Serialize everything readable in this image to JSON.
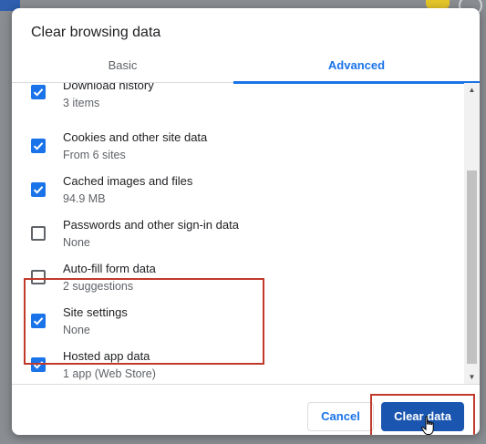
{
  "dialog": {
    "title": "Clear browsing data",
    "tabs": [
      {
        "label": "Basic",
        "selected": false
      },
      {
        "label": "Advanced",
        "selected": true
      }
    ],
    "items": [
      {
        "label": "Download history",
        "detail": "3 items",
        "checked": true
      },
      {
        "label": "Cookies and other site data",
        "detail": "From 6 sites",
        "checked": true
      },
      {
        "label": "Cached images and files",
        "detail": "94.9 MB",
        "checked": true
      },
      {
        "label": "Passwords and other sign-in data",
        "detail": "None",
        "checked": false
      },
      {
        "label": "Auto-fill form data",
        "detail": "2 suggestions",
        "checked": false
      },
      {
        "label": "Site settings",
        "detail": "None",
        "checked": true
      },
      {
        "label": "Hosted app data",
        "detail": "1 app (Web Store)",
        "checked": true
      }
    ],
    "buttons": {
      "cancel": "Cancel",
      "clear": "Clear data"
    }
  },
  "colors": {
    "accent": "#1a73e8",
    "primary_button": "#1a56b0",
    "highlight_outline": "#c0392b"
  },
  "icons": {
    "checkbox_checked": "checkmark-icon",
    "scroll_up": "chevron-up-icon",
    "scroll_down": "chevron-down-icon",
    "cursor": "hand-pointer-icon"
  }
}
